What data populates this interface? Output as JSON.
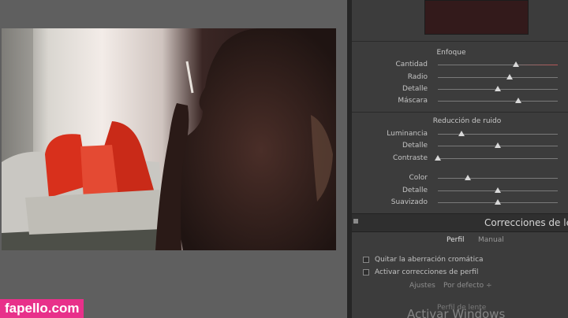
{
  "detail": {
    "title": "Enfoque",
    "sliders": [
      {
        "label": "Cantidad",
        "value": 0.65
      },
      {
        "label": "Radio",
        "value": 0.6
      },
      {
        "label": "Detalle",
        "value": 0.5
      },
      {
        "label": "Máscara",
        "value": 0.67
      }
    ]
  },
  "noise": {
    "title": "Reducción de ruido",
    "sliders": [
      {
        "label": "Luminancia",
        "value": 0.2
      },
      {
        "label": "Detalle",
        "value": 0.5
      },
      {
        "label": "Contraste",
        "value": 0.0
      },
      {
        "label": "Color",
        "value": 0.25
      },
      {
        "label": "Detalle",
        "value": 0.5
      },
      {
        "label": "Suavizado",
        "value": 0.5
      }
    ]
  },
  "lens": {
    "header": "Correcciones de lente",
    "tabs": [
      "Perfil",
      "Manual"
    ],
    "checks": [
      {
        "label": "Quitar la aberración cromática"
      },
      {
        "label": "Activar correcciones de perfil"
      }
    ],
    "ajustes_label": "Ajustes",
    "ajustes_value": "Por defecto ÷",
    "perfil_lente": "Perfil de lente"
  },
  "overlay": {
    "windows": "Activar Windows",
    "site": "fapello.com"
  }
}
